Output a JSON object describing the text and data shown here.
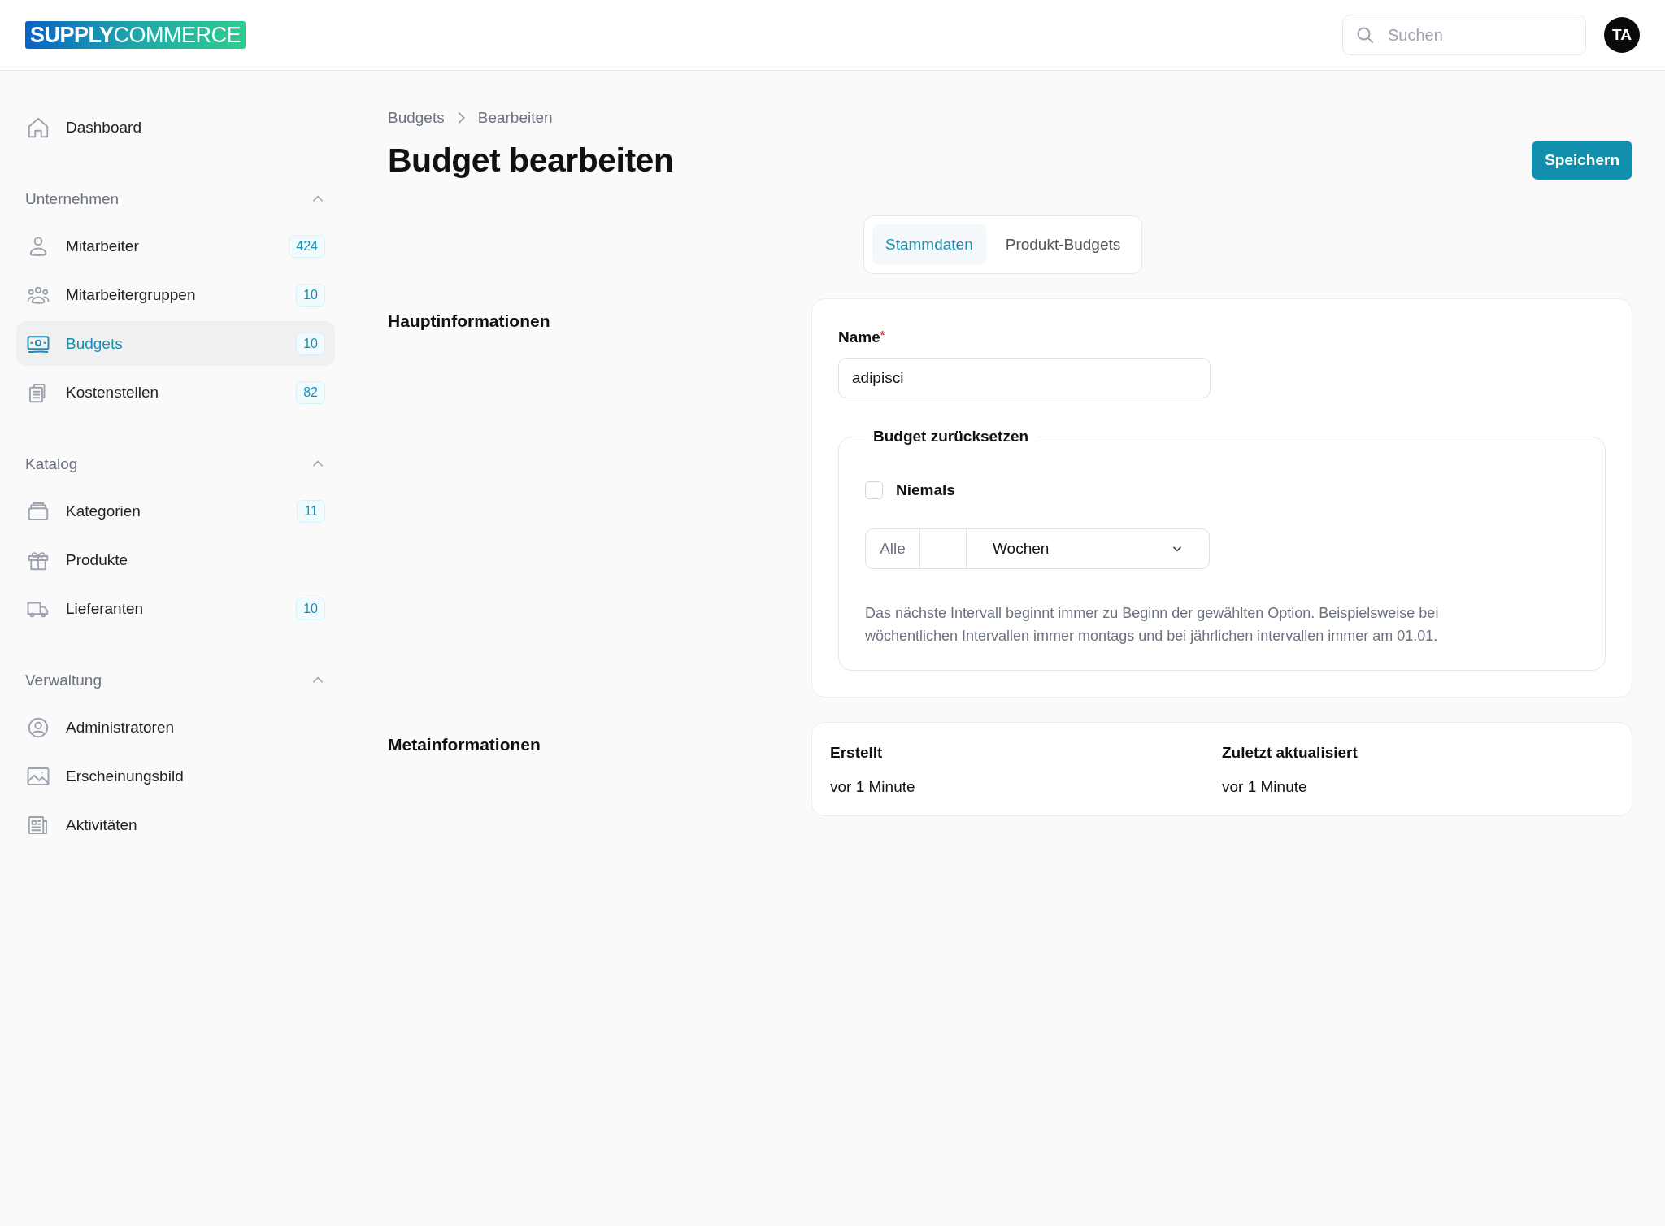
{
  "header": {
    "logo": "**SUPPLY**COMMERCE",
    "search": {
      "placeholder": "Suchen"
    },
    "avatar": "TA"
  },
  "sidebar": {
    "top": [
      {
        "label": "Dashboard",
        "selected": false
      }
    ],
    "sections": [
      {
        "title": "Unternehmen",
        "expanded": true,
        "items": [
          {
            "label": "Mitarbeiter",
            "count": "424",
            "selected": false
          },
          {
            "label": "Mitarbeitergruppen",
            "count": "10",
            "selected": false
          },
          {
            "label": "Budgets",
            "count": "10",
            "selected": true
          },
          {
            "label": "Kostenstellen",
            "count": "82",
            "selected": false
          }
        ]
      },
      {
        "title": "Katalog",
        "expanded": true,
        "items": [
          {
            "label": "Kategorien",
            "count": "11",
            "selected": false
          },
          {
            "label": "Produkte",
            "selected": false
          },
          {
            "label": "Lieferanten",
            "count": "10",
            "selected": false
          }
        ]
      },
      {
        "title": "Verwaltung",
        "expanded": true,
        "items": [
          {
            "label": "Administratoren",
            "selected": false
          },
          {
            "label": "Erscheinungsbild",
            "selected": false
          },
          {
            "label": "Aktivitäten",
            "selected": false
          }
        ]
      }
    ]
  },
  "breadcrumb": [
    "Budgets",
    "Bearbeiten"
  ],
  "title": "Budget bearbeiten",
  "save_button": "Speichern",
  "tabs": [
    {
      "label": "Stammdaten",
      "selected": true
    },
    {
      "label": "Produkt-Budgets",
      "selected": false
    }
  ],
  "main_section": {
    "heading": "Hauptinformationen",
    "name_field": {
      "label": "Name",
      "required_mark": "*",
      "value": "adipisci"
    },
    "reset": {
      "legend": "Budget zurücksetzen",
      "never": {
        "label": "Niemals",
        "checked": false
      },
      "prefix": "Alle",
      "unit": "Wochen",
      "help": "Das nächste Intervall beginnt immer zu Beginn der gewählten Option. Beispielsweise bei wöchentlichen Intervallen immer montags und bei jährlichen intervallen immer am 01.01."
    }
  },
  "meta_section": {
    "heading": "Metainformationen",
    "fields": [
      {
        "label": "Erstellt",
        "value": "vor 1 Minute"
      },
      {
        "label": "Zuletzt aktualisiert",
        "value": "vor 1 Minute"
      }
    ]
  }
}
